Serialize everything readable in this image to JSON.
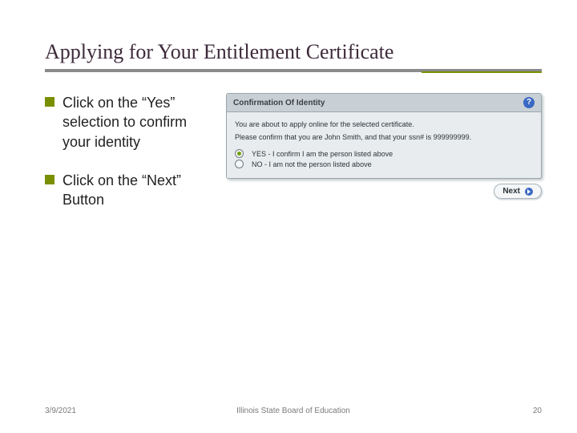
{
  "title": "Applying for Your Entitlement Certificate",
  "bullets": [
    "Click on the “Yes” selection to confirm your identity",
    "Click on the “Next” Button"
  ],
  "panel": {
    "title": "Confirmation Of Identity",
    "para1": "You are about to apply online for the selected certificate.",
    "para2": "Please confirm that you are John Smith, and that your ssn# is 999999999.",
    "options": [
      {
        "label": "YES - I confirm I am the person listed above",
        "selected": true
      },
      {
        "label": "NO - I am not the person listed above",
        "selected": false
      }
    ],
    "next_label": "Next"
  },
  "footer": {
    "date": "3/9/2021",
    "center": "Illinois State Board of Education",
    "page": "20"
  }
}
